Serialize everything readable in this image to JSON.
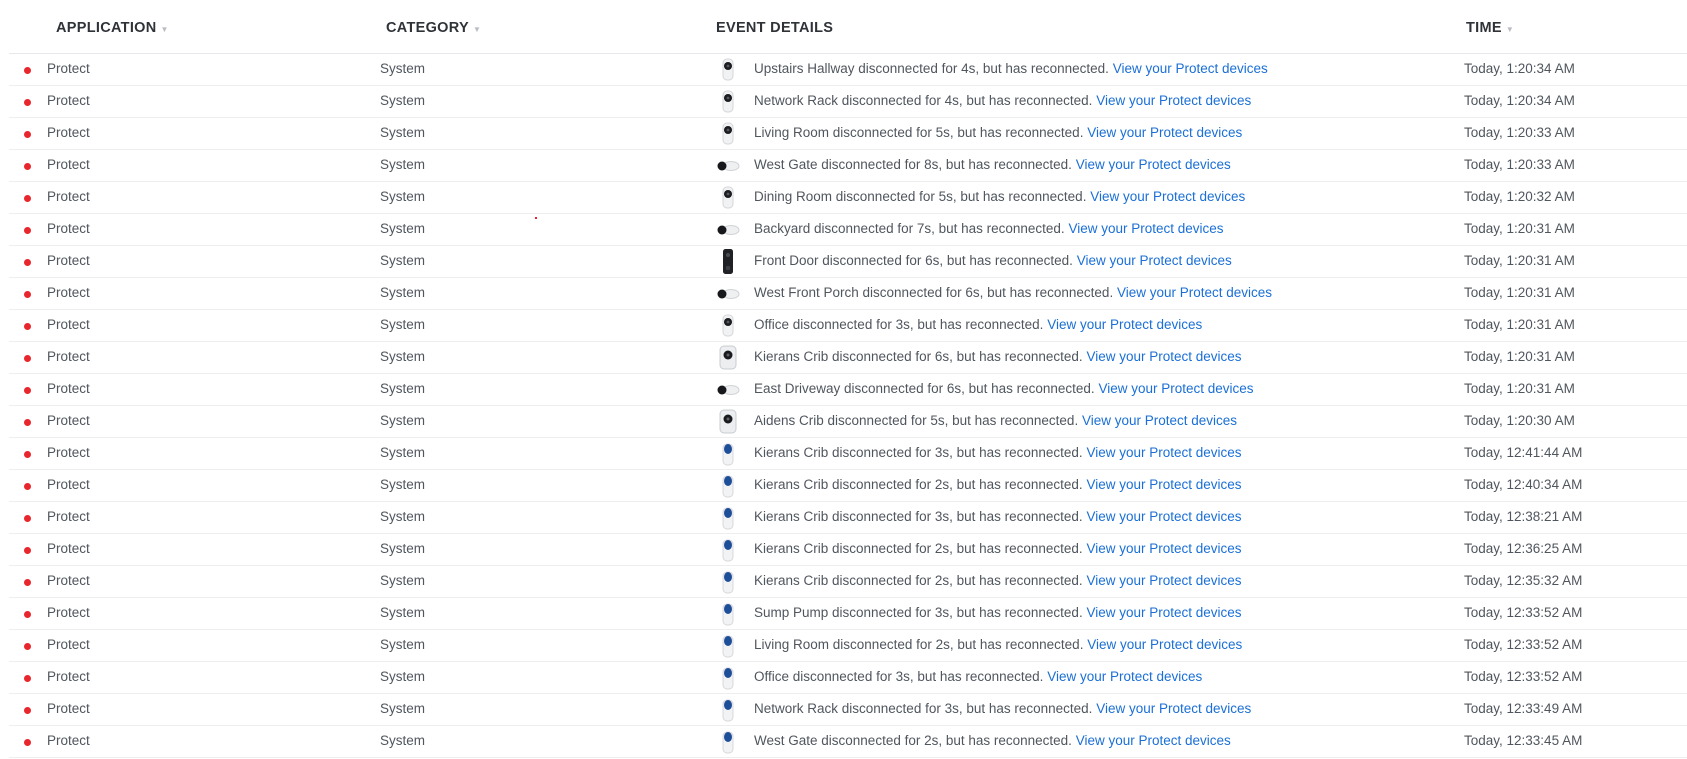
{
  "columns": {
    "application": "APPLICATION",
    "category": "CATEGORY",
    "event_details": "EVENT DETAILS",
    "time": "TIME"
  },
  "colors": {
    "status_dot": "#e8262d",
    "link": "#1a6fd6",
    "text": "#50565e"
  },
  "rows": [
    {
      "app": "Protect",
      "category": "System",
      "device": "dome-camera-icon",
      "detail": "Upstairs Hallway disconnected for 4s, but has reconnected.",
      "link": "View your Protect devices",
      "time": "Today, 1:20:34 AM"
    },
    {
      "app": "Protect",
      "category": "System",
      "device": "dome-camera-icon",
      "detail": "Network Rack disconnected for 4s, but has reconnected.",
      "link": "View your Protect devices",
      "time": "Today, 1:20:34 AM"
    },
    {
      "app": "Protect",
      "category": "System",
      "device": "dome-camera-icon",
      "detail": "Living Room disconnected for 5s, but has reconnected.",
      "link": "View your Protect devices",
      "time": "Today, 1:20:33 AM"
    },
    {
      "app": "Protect",
      "category": "System",
      "device": "bullet-camera-icon",
      "detail": "West Gate disconnected for 8s, but has reconnected.",
      "link": "View your Protect devices",
      "time": "Today, 1:20:33 AM"
    },
    {
      "app": "Protect",
      "category": "System",
      "device": "dome-camera-icon",
      "detail": "Dining Room disconnected for 5s, but has reconnected.",
      "link": "View your Protect devices",
      "time": "Today, 1:20:32 AM"
    },
    {
      "app": "Protect",
      "category": "System",
      "device": "bullet-camera-icon",
      "detail": "Backyard disconnected for 7s, but has reconnected.",
      "link": "View your Protect devices",
      "time": "Today, 1:20:31 AM"
    },
    {
      "app": "Protect",
      "category": "System",
      "device": "doorbell-icon",
      "detail": "Front Door disconnected for 6s, but has reconnected.",
      "link": "View your Protect devices",
      "time": "Today, 1:20:31 AM"
    },
    {
      "app": "Protect",
      "category": "System",
      "device": "bullet-camera-icon",
      "detail": "West Front Porch disconnected for 6s, but has reconnected.",
      "link": "View your Protect devices",
      "time": "Today, 1:20:31 AM"
    },
    {
      "app": "Protect",
      "category": "System",
      "device": "dome-camera-icon",
      "detail": "Office disconnected for 3s, but has reconnected.",
      "link": "View your Protect devices",
      "time": "Today, 1:20:31 AM"
    },
    {
      "app": "Protect",
      "category": "System",
      "device": "box-camera-icon",
      "detail": "Kierans Crib disconnected for 6s, but has reconnected.",
      "link": "View your Protect devices",
      "time": "Today, 1:20:31 AM"
    },
    {
      "app": "Protect",
      "category": "System",
      "device": "bullet-camera-icon",
      "detail": "East Driveway disconnected for 6s, but has reconnected.",
      "link": "View your Protect devices",
      "time": "Today, 1:20:31 AM"
    },
    {
      "app": "Protect",
      "category": "System",
      "device": "box-camera-icon",
      "detail": "Aidens Crib disconnected for 5s, but has reconnected.",
      "link": "View your Protect devices",
      "time": "Today, 1:20:30 AM"
    },
    {
      "app": "Protect",
      "category": "System",
      "device": "sensor-icon",
      "detail": "Kierans Crib disconnected for 3s, but has reconnected.",
      "link": "View your Protect devices",
      "time": "Today, 12:41:44 AM"
    },
    {
      "app": "Protect",
      "category": "System",
      "device": "sensor-icon",
      "detail": "Kierans Crib disconnected for 2s, but has reconnected.",
      "link": "View your Protect devices",
      "time": "Today, 12:40:34 AM"
    },
    {
      "app": "Protect",
      "category": "System",
      "device": "sensor-icon",
      "detail": "Kierans Crib disconnected for 3s, but has reconnected.",
      "link": "View your Protect devices",
      "time": "Today, 12:38:21 AM"
    },
    {
      "app": "Protect",
      "category": "System",
      "device": "sensor-icon",
      "detail": "Kierans Crib disconnected for 2s, but has reconnected.",
      "link": "View your Protect devices",
      "time": "Today, 12:36:25 AM"
    },
    {
      "app": "Protect",
      "category": "System",
      "device": "sensor-icon",
      "detail": "Kierans Crib disconnected for 2s, but has reconnected.",
      "link": "View your Protect devices",
      "time": "Today, 12:35:32 AM"
    },
    {
      "app": "Protect",
      "category": "System",
      "device": "sensor-icon",
      "detail": "Sump Pump disconnected for 3s, but has reconnected.",
      "link": "View your Protect devices",
      "time": "Today, 12:33:52 AM"
    },
    {
      "app": "Protect",
      "category": "System",
      "device": "sensor-icon",
      "detail": "Living Room disconnected for 2s, but has reconnected.",
      "link": "View your Protect devices",
      "time": "Today, 12:33:52 AM"
    },
    {
      "app": "Protect",
      "category": "System",
      "device": "sensor-icon",
      "detail": "Office disconnected for 3s, but has reconnected.",
      "link": "View your Protect devices",
      "time": "Today, 12:33:52 AM"
    },
    {
      "app": "Protect",
      "category": "System",
      "device": "sensor-icon",
      "detail": "Network Rack disconnected for 3s, but has reconnected.",
      "link": "View your Protect devices",
      "time": "Today, 12:33:49 AM"
    },
    {
      "app": "Protect",
      "category": "System",
      "device": "sensor-icon",
      "detail": "West Gate disconnected for 2s, but has reconnected.",
      "link": "View your Protect devices",
      "time": "Today, 12:33:45 AM"
    }
  ]
}
